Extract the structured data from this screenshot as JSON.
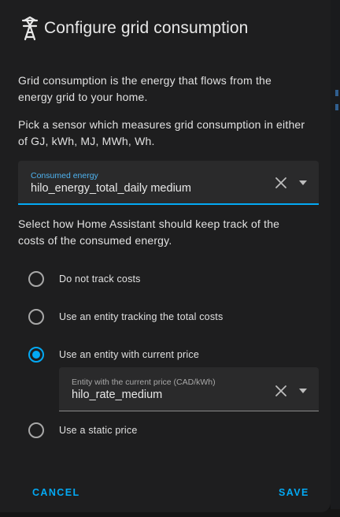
{
  "dialog": {
    "title": "Configure grid consumption",
    "title_icon": "transmission-tower-icon",
    "intro": "Grid consumption is the energy that flows from the energy grid to your home.",
    "sensor_hint": "Pick a sensor which measures grid consumption in either of GJ, kWh, MJ, MWh, Wh.",
    "consumed_field": {
      "label": "Consumed energy",
      "value": "hilo_energy_total_daily medium"
    },
    "cost_hint": "Select how Home Assistant should keep track of the costs of the consumed energy.",
    "cost_options": [
      {
        "label": "Do not track costs",
        "checked": false
      },
      {
        "label": "Use an entity tracking the total costs",
        "checked": false
      },
      {
        "label": "Use an entity with current price",
        "checked": true
      },
      {
        "label": "Use a static price",
        "checked": false
      }
    ],
    "price_field": {
      "label": "Entity with the current price (CAD/kWh)",
      "value": "hilo_rate_medium"
    },
    "cancel_label": "CANCEL",
    "save_label": "SAVE"
  },
  "colors": {
    "accent": "#03a9f4",
    "surface": "#1e1e1f",
    "field_bg": "#2a2a2b",
    "text": "#e1e1e1"
  }
}
